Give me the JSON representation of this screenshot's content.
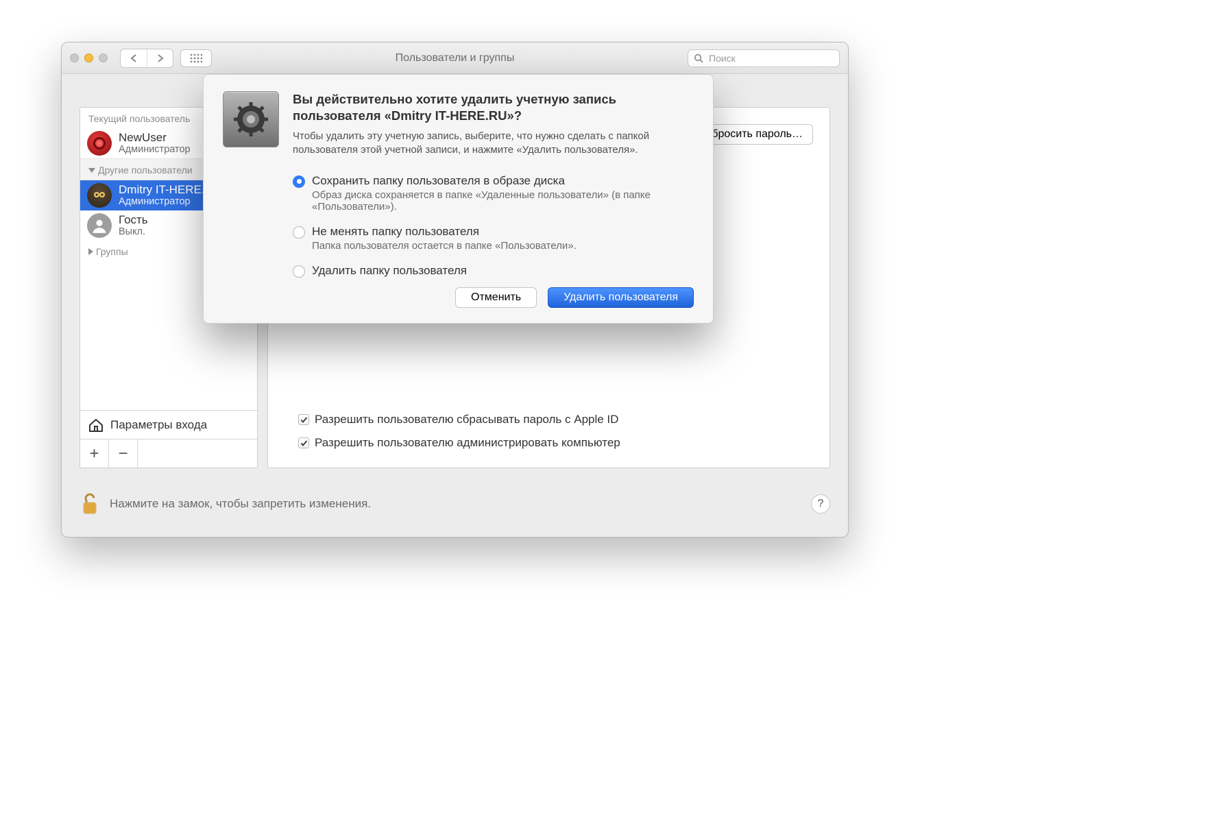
{
  "window": {
    "title": "Пользователи и группы",
    "search_placeholder": "Поиск"
  },
  "sidebar": {
    "current_user_header": "Текущий пользователь",
    "other_users_header": "Другие пользователи",
    "groups_header": "Группы",
    "login_options_label": "Параметры входа",
    "users": [
      {
        "name": "NewUser",
        "sub": "Администратор"
      },
      {
        "name": "Dmitry IT-HERE.RU",
        "sub": "Администратор"
      },
      {
        "name": "Гость",
        "sub": "Выкл."
      }
    ]
  },
  "panel": {
    "change_password_button": "Сбросить пароль…",
    "checkbox_apple_id": "Разрешить пользователю сбрасывать пароль с Apple ID",
    "checkbox_admin": "Разрешить пользователю администрировать компьютер"
  },
  "lock": {
    "hint": "Нажмите на замок, чтобы запретить изменения."
  },
  "dialog": {
    "title": "Вы действительно хотите удалить учетную запись пользователя «Dmitry IT-HERE.RU»?",
    "desc": "Чтобы удалить эту учетную запись, выберите, что нужно сделать с папкой пользователя этой учетной записи, и нажмите «Удалить пользователя».",
    "options": [
      {
        "label": "Сохранить папку пользователя в образе диска",
        "sub": "Образ диска сохраняется в папке «Удаленные пользователи» (в папке «Пользователи»).",
        "selected": true
      },
      {
        "label": "Не менять папку пользователя",
        "sub": "Папка пользователя остается в папке «Пользователи».",
        "selected": false
      },
      {
        "label": "Удалить папку пользователя",
        "sub": "",
        "selected": false
      }
    ],
    "cancel": "Отменить",
    "confirm": "Удалить пользователя"
  }
}
